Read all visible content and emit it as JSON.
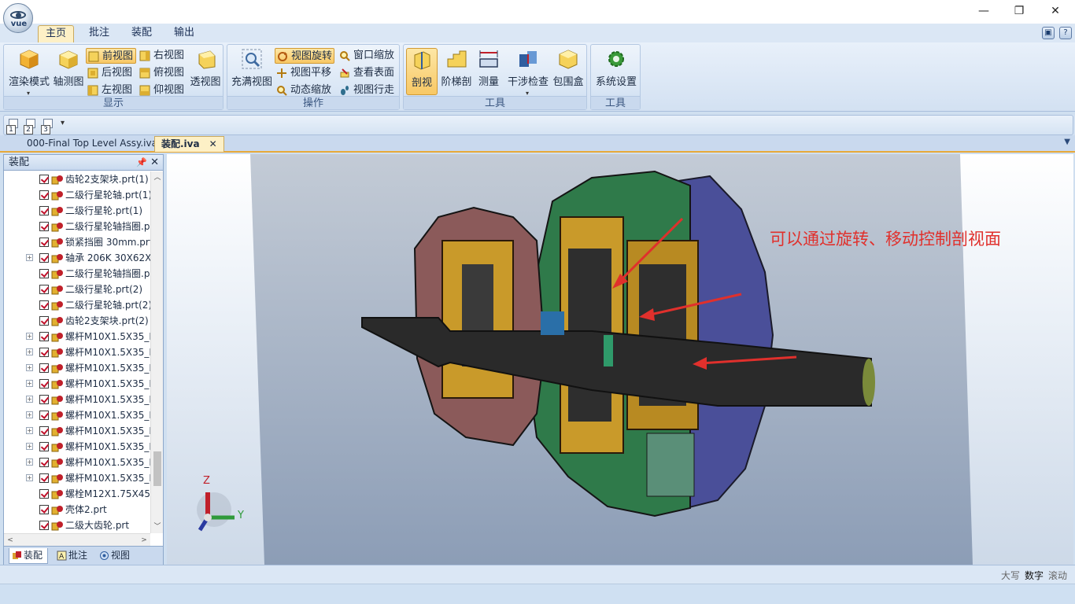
{
  "app": {
    "logo_text": "vue"
  },
  "window_controls": {
    "minimize": "—",
    "restore": "❐",
    "close": "✕"
  },
  "ribbon_tabs": [
    {
      "label": "主页",
      "active": true
    },
    {
      "label": "批注",
      "active": false
    },
    {
      "label": "装配",
      "active": false
    },
    {
      "label": "输出",
      "active": false
    }
  ],
  "ribbon": {
    "display": {
      "label": "显示",
      "render_mode": "渲染模式",
      "axonometric": "轴测图",
      "front": "前视图",
      "back": "后视图",
      "left": "左视图",
      "right": "右视图",
      "top": "俯视图",
      "bottom": "仰视图",
      "perspective": "透视图"
    },
    "operation": {
      "label": "操作",
      "fit_view": "充满视图",
      "rotate": "视图旋转",
      "pan": "视图平移",
      "dynamic_zoom": "动态缩放",
      "window_zoom": "窗口缩放",
      "inspect_surface": "查看表面",
      "walk": "视图行走"
    },
    "tools": {
      "label": "工具",
      "section": "剖视",
      "step_section": "阶梯剖",
      "measure": "测量",
      "interference": "干涉检查",
      "bounding_box": "包围盒"
    },
    "tools2": {
      "label": "工具",
      "settings": "系统设置"
    }
  },
  "quick_access": [
    "1",
    "2",
    "3"
  ],
  "doc_tabs": [
    {
      "label": "000-Final Top Level Assy.iva",
      "active": false
    },
    {
      "label": "装配.iva",
      "active": true
    }
  ],
  "panel": {
    "title": "装配",
    "items": [
      {
        "label": "齿轮2支架块.prt(1)",
        "expand": false
      },
      {
        "label": "二级行星轮轴.prt(1)",
        "expand": false
      },
      {
        "label": "二级行星轮.prt(1)",
        "expand": false
      },
      {
        "label": "二级行星轮轴挡圈.p",
        "expand": false
      },
      {
        "label": "锁紧挡圈 30mm.prt",
        "expand": false
      },
      {
        "label": "轴承 206K 30X62X",
        "expand": true
      },
      {
        "label": "二级行星轮轴挡圈.p",
        "expand": false
      },
      {
        "label": "二级行星轮.prt(2)",
        "expand": false
      },
      {
        "label": "二级行星轮轴.prt(2)",
        "expand": false
      },
      {
        "label": "齿轮2支架块.prt(2)",
        "expand": false
      },
      {
        "label": "螺杆M10X1.5X35_N",
        "expand": true
      },
      {
        "label": "螺杆M10X1.5X35_N",
        "expand": true
      },
      {
        "label": "螺杆M10X1.5X35_N",
        "expand": true
      },
      {
        "label": "螺杆M10X1.5X35_N",
        "expand": true
      },
      {
        "label": "螺杆M10X1.5X35_N",
        "expand": true
      },
      {
        "label": "螺杆M10X1.5X35_N",
        "expand": true
      },
      {
        "label": "螺杆M10X1.5X35_N",
        "expand": true
      },
      {
        "label": "螺杆M10X1.5X35_N",
        "expand": true
      },
      {
        "label": "螺杆M10X1.5X35_N",
        "expand": true
      },
      {
        "label": "螺杆M10X1.5X35_N",
        "expand": true
      },
      {
        "label": "螺栓M12X1.75X45.",
        "expand": false
      },
      {
        "label": "壳体2.prt",
        "expand": false
      },
      {
        "label": "二级大齿轮.prt",
        "expand": false
      }
    ],
    "tabs": [
      {
        "label": "装配",
        "active": true
      },
      {
        "label": "批注",
        "active": false
      },
      {
        "label": "视图",
        "active": false
      }
    ]
  },
  "viewport": {
    "annotation": "可以通过旋转、移动控制剖视面",
    "axis_x": "Z",
    "axis_y": "Y"
  },
  "status": {
    "caps": "大写",
    "num": "数字",
    "scroll": "滚动"
  },
  "colors": {
    "ribbon_selected": "#f8c865",
    "annotation": "#e0302c",
    "checkmark": "#c0102a",
    "model_green": "#2f7a4a",
    "model_gold": "#c99a2a",
    "model_blue": "#4a4f99"
  }
}
